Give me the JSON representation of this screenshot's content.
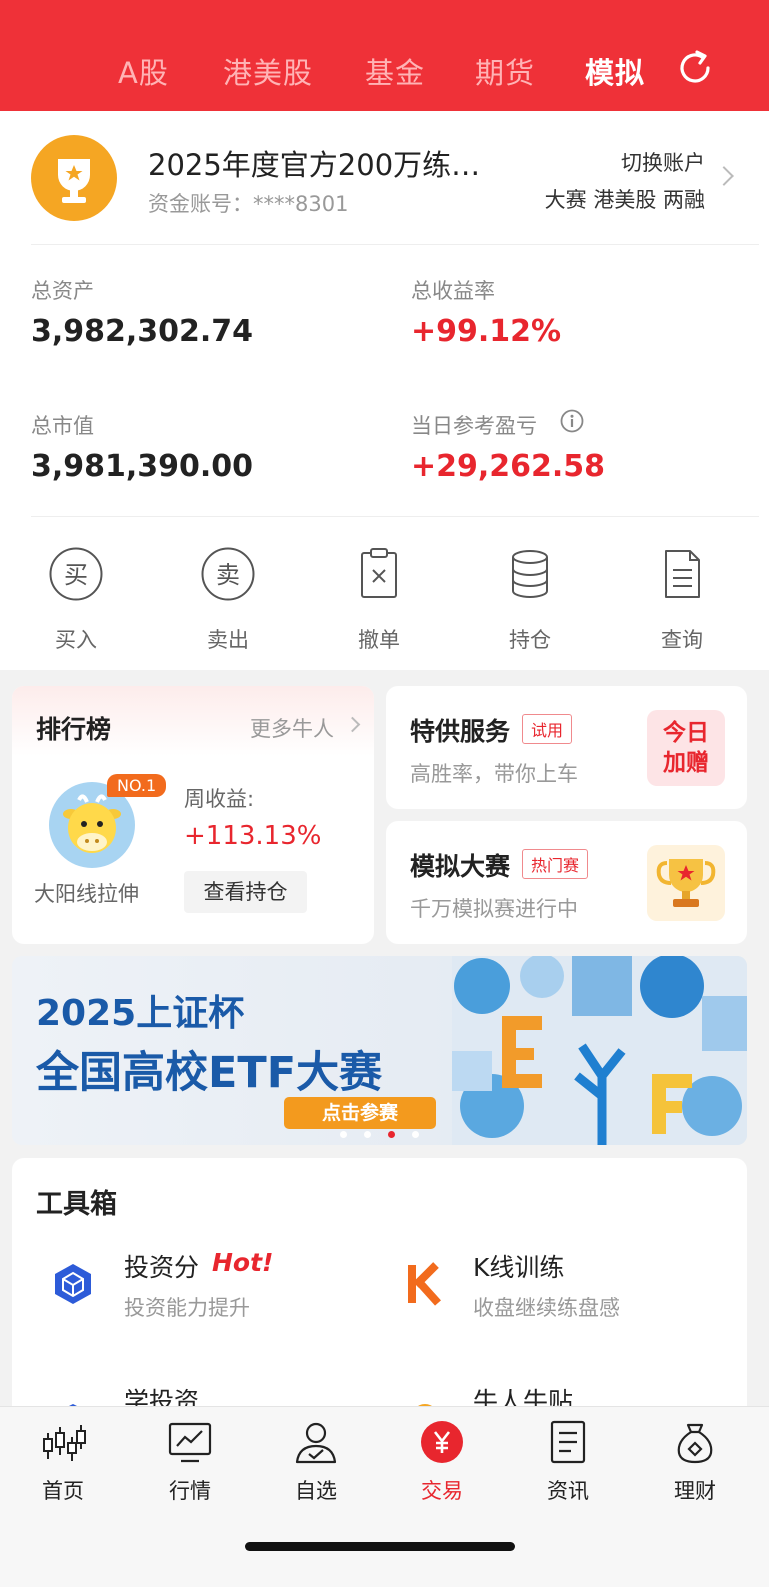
{
  "top_tabs": [
    {
      "label": "A股",
      "active": false
    },
    {
      "label": "港美股",
      "active": false
    },
    {
      "label": "基金",
      "active": false
    },
    {
      "label": "期货",
      "active": false
    },
    {
      "label": "模拟",
      "active": true
    }
  ],
  "account": {
    "name": "2025年度官方200万练…",
    "account_no_label": "资金账号：",
    "account_no": "****8301",
    "switch_label": "切换账户",
    "tags": "大赛 港美股 两融"
  },
  "stats": {
    "total_assets_label": "总资产",
    "total_assets": "3,982,302.74",
    "total_return_label": "总收益率",
    "total_return": "+99.12%",
    "market_value_label": "总市值",
    "market_value": "3,981,390.00",
    "daily_pnl_label": "当日参考盈亏",
    "daily_pnl": "+29,262.58"
  },
  "actions": [
    {
      "label": "买入",
      "glyph": "买"
    },
    {
      "label": "卖出",
      "glyph": "卖"
    },
    {
      "label": "撤单"
    },
    {
      "label": "持仓"
    },
    {
      "label": "查询"
    }
  ],
  "ranking": {
    "title": "排行榜",
    "more": "更多牛人",
    "badge": "NO.1",
    "user": "大阳线拉伸",
    "week_label": "周收益:",
    "week_value": "+113.13%",
    "view_button": "查看持仓"
  },
  "special_service": {
    "title": "特供服务",
    "tag": "试用",
    "subtitle": "高胜率，带你上车",
    "badge_line1": "今日",
    "badge_line2": "加赠"
  },
  "sim_contest": {
    "title": "模拟大赛",
    "tag": "热门赛",
    "subtitle": "千万模拟赛进行中"
  },
  "banner": {
    "line1": "2025上证杯",
    "line2": "全国高校ETF大赛",
    "button": "点击参赛",
    "active_dot": 3
  },
  "toolbox": {
    "title": "工具箱",
    "items": [
      {
        "name": "投资分",
        "badge": "Hot!",
        "subtitle": "投资能力提升"
      },
      {
        "name": "K线训练",
        "subtitle": "收盘继续练盘感"
      },
      {
        "name": "学投资"
      },
      {
        "name": "牛人牛贴"
      }
    ]
  },
  "bottom_nav": [
    {
      "label": "首页",
      "active": false
    },
    {
      "label": "行情",
      "active": false
    },
    {
      "label": "自选",
      "active": false
    },
    {
      "label": "交易",
      "active": true
    },
    {
      "label": "资讯",
      "active": false
    },
    {
      "label": "理财",
      "active": false
    }
  ],
  "colors": {
    "brand_red": "#ef3138",
    "up_red": "#e8262e",
    "orange": "#f5a623"
  }
}
